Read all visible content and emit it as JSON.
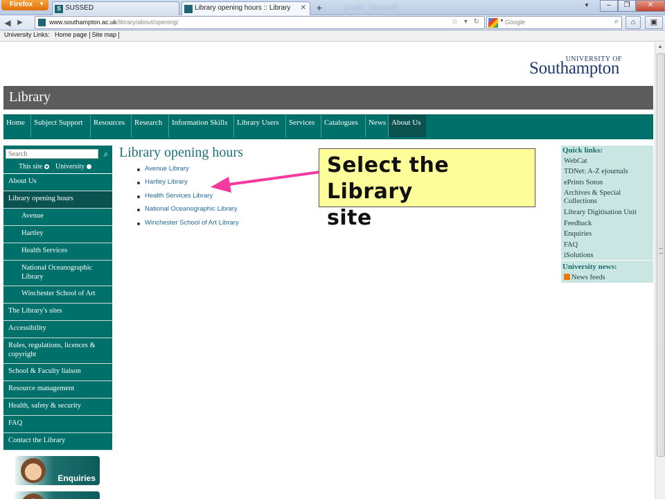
{
  "browser": {
    "menu_button": "Firefox",
    "tabs": [
      {
        "favicon": "S",
        "title": "SUSSED"
      },
      {
        "favicon": "",
        "title": "Library opening hours :: Library"
      }
    ],
    "ghost_tab": "Ungild - Microsoft PowerPoint",
    "url_domain": "www.southampton.ac.uk",
    "url_path": "/library/about/opening/",
    "search_placeholder": "Google",
    "bookmarks": [
      "University Links:",
      "Home page",
      "Site map"
    ]
  },
  "logo": {
    "top_line": "UNIVERSITY OF",
    "name": "Southampton"
  },
  "banner_title": "Library",
  "main_nav": [
    "Home",
    "Subject Support",
    "Resources",
    "Research",
    "Information Skills",
    "Library Users",
    "Services",
    "Catalogues",
    "News",
    "About Us"
  ],
  "main_nav_active": "About Us",
  "sidebar": {
    "search_placeholder": "Search",
    "scope_this_site": "This site",
    "scope_university": "University",
    "items": [
      {
        "label": "About Us",
        "level": 0
      },
      {
        "label": "Library opening hours",
        "level": 0,
        "active": true
      },
      {
        "label": "Avenue",
        "level": 1
      },
      {
        "label": "Hartley",
        "level": 1
      },
      {
        "label": "Health Services",
        "level": 1
      },
      {
        "label": "National Oceanographic Library",
        "level": 1
      },
      {
        "label": "Winchester School of Art",
        "level": 1
      },
      {
        "label": "The Library's sites",
        "level": 0
      },
      {
        "label": "Accessibility",
        "level": 0
      },
      {
        "label": "Rules, regulations, licences & copyright",
        "level": 0
      },
      {
        "label": "School & Faculty liaison",
        "level": 0
      },
      {
        "label": "Resource management",
        "level": 0
      },
      {
        "label": "Health, safety & security",
        "level": 0
      },
      {
        "label": "FAQ",
        "level": 0
      },
      {
        "label": "Contact the Library",
        "level": 0
      }
    ],
    "promo_label": "Enquiries"
  },
  "content": {
    "title": "Library opening hours",
    "libraries": [
      "Avenue Library",
      "Hartley Library",
      "Health Services Library",
      "National Oceanographic Library",
      "Winchester School of Art Library"
    ]
  },
  "callout": {
    "line1": "Select the Library",
    "line2": "site",
    "color": "#fdfd99",
    "arrow_color": "#f43a9e"
  },
  "quick_links": {
    "heading": "Quick links:",
    "links": [
      "WebCat",
      "TDNet: A-Z ejournals",
      "ePrints Soton",
      "Archives & Special Collections",
      "Library Digitisation Unit",
      "Feedback",
      "Enquiries",
      "FAQ",
      "iSolutions"
    ],
    "news_heading": "University news:",
    "news_link": "News feeds"
  },
  "colors": {
    "teal": "#00706a",
    "teal_dark": "#0a524f",
    "banner_grey": "#5c5c5c",
    "title_teal": "#1d6f78",
    "link_blue": "#1f6a9a"
  }
}
